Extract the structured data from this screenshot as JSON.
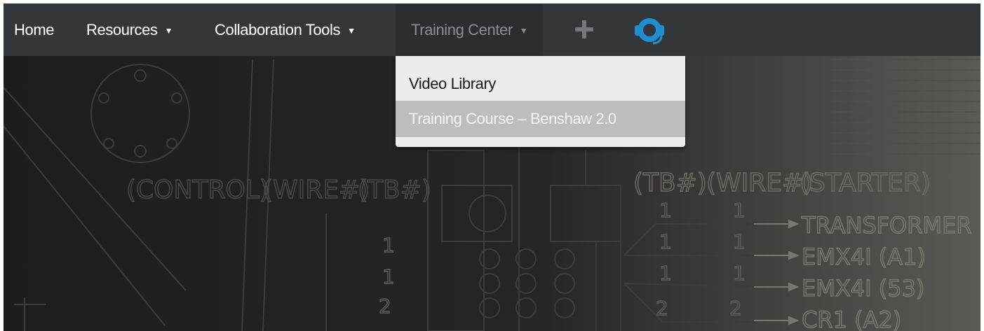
{
  "navbar": {
    "items": [
      {
        "label": "Home"
      },
      {
        "label": "Resources",
        "caret": "▼"
      },
      {
        "label": "Collaboration Tools",
        "caret": "▼"
      },
      {
        "label": "Training Center",
        "caret": "▼"
      }
    ],
    "icons": {
      "add": "plus-icon",
      "support": "headset-icon"
    }
  },
  "dropdown": {
    "items": [
      {
        "label": "Video Library"
      },
      {
        "label": "Training Course – Benshaw 2.0"
      }
    ]
  },
  "background": {
    "left_labels": {
      "control": "(CONTROL)",
      "wire": "(WIRE#)",
      "tb": "(TB#)"
    },
    "right_labels": {
      "tb": "(TB#)",
      "wire": "(WIRE#)",
      "starter": "(STARTER)"
    },
    "rows": [
      {
        "tb": "1",
        "wire": "1",
        "dest": "TRANSFORMER"
      },
      {
        "tb": "1",
        "wire": "1",
        "dest": "EMX4I  (A1)"
      },
      {
        "tb": "1",
        "wire": "1",
        "dest": "EMX4I  (53)"
      },
      {
        "tb": "2",
        "wire": "2",
        "dest": "CR1  (A2)"
      }
    ],
    "left_numbers": [
      "1",
      "1",
      "2"
    ]
  },
  "colors": {
    "navbar": "#34373a",
    "nav_active": "#2b2e31",
    "support_accent": "#1e90d0",
    "dropdown_bg": "#ececec",
    "dropdown_highlight": "#bdbdbd"
  }
}
